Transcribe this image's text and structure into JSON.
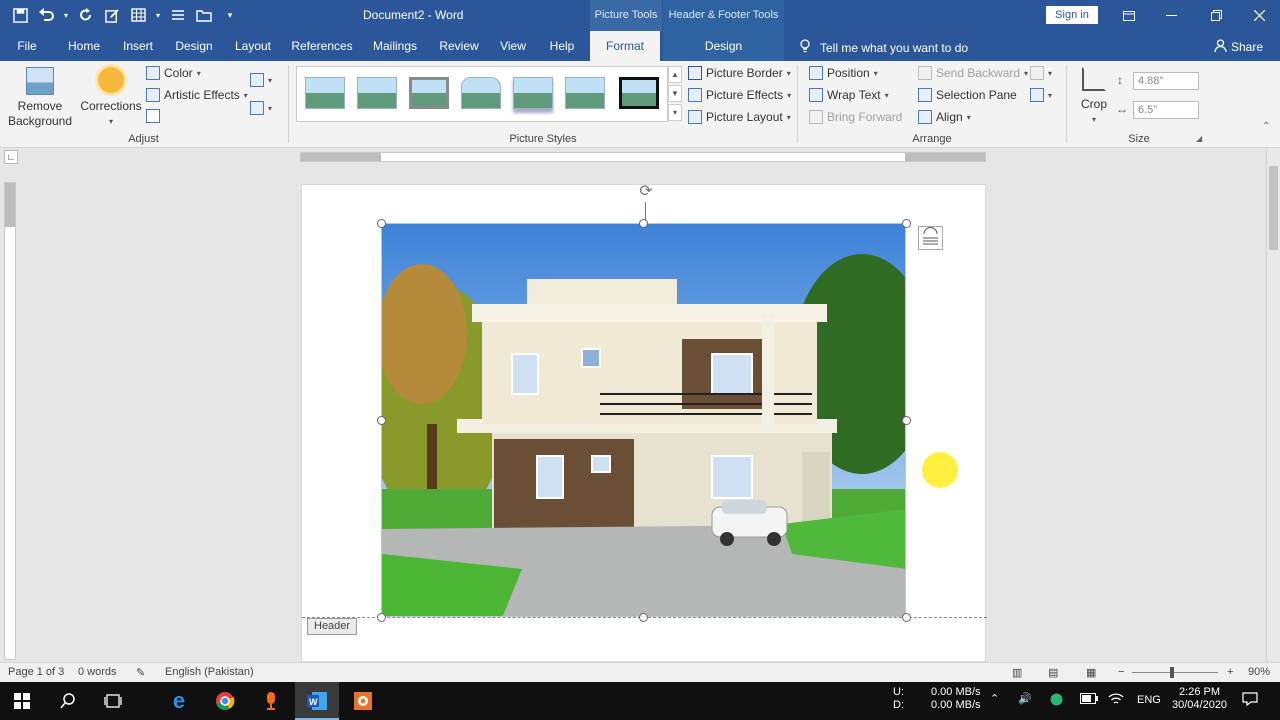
{
  "app": {
    "title": "Document2 - Word",
    "context_picture": "Picture Tools",
    "context_header": "Header & Footer Tools",
    "sign_in": "Sign in"
  },
  "tabs": {
    "file": "File",
    "home": "Home",
    "insert": "Insert",
    "design": "Design",
    "layout": "Layout",
    "references": "References",
    "mailings": "Mailings",
    "review": "Review",
    "view": "View",
    "help": "Help",
    "format": "Format",
    "hf_design": "Design",
    "tell_me": "Tell me what you want to do",
    "share": "Share"
  },
  "ribbon": {
    "adjust": {
      "remove_bg_l1": "Remove",
      "remove_bg_l2": "Background",
      "corrections": "Corrections",
      "color": "Color",
      "artistic": "Artistic Effects",
      "label": "Adjust"
    },
    "styles": {
      "label": "Picture Styles",
      "border": "Picture Border",
      "effects": "Picture Effects",
      "layout": "Picture Layout"
    },
    "arrange": {
      "label": "Arrange",
      "position": "Position",
      "wrap": "Wrap Text",
      "bring": "Bring Forward",
      "send": "Send Backward",
      "selection": "Selection Pane",
      "align": "Align"
    },
    "size": {
      "label": "Size",
      "crop": "Crop",
      "height": "4.88\"",
      "width": "6.5\""
    }
  },
  "document": {
    "header_tag": "Header"
  },
  "status": {
    "page": "Page 1 of 3",
    "words": "0 words",
    "language": "English (Pakistan)",
    "zoom": "90%"
  },
  "taskbar": {
    "net_u": "U:",
    "net_d": "D:",
    "up_rate": "0.00 MB/s",
    "down_rate": "0.00 MB/s",
    "lang": "ENG",
    "time": "2:26 PM",
    "date": "30/04/2020"
  },
  "colors": {
    "word_blue": "#2b579a",
    "ribbon_bg": "#f3f3f3"
  }
}
